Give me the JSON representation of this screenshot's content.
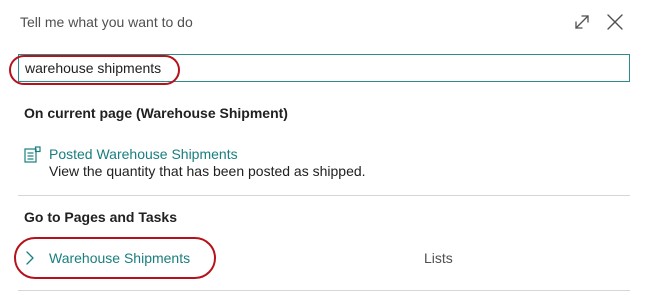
{
  "dialog": {
    "title": "Tell me what you want to do",
    "icons": {
      "expand": "expand-icon",
      "close": "close-icon"
    }
  },
  "search": {
    "value": "warehouse shipments",
    "placeholder": ""
  },
  "sections": {
    "current_page": {
      "heading": "On current page (Warehouse Shipment)",
      "results": [
        {
          "title": "Posted Warehouse Shipments",
          "description": "View the quantity that has been posted as shipped.",
          "icon": "report-icon"
        }
      ]
    },
    "pages_tasks": {
      "heading": "Go to Pages and Tasks",
      "results": [
        {
          "title": "Warehouse Shipments",
          "category": "Lists",
          "icon": "chevron-right-icon"
        }
      ]
    }
  },
  "colors": {
    "accent": "#1a7e7e",
    "highlight": "#b5121b",
    "border": "#2e8b8b"
  }
}
